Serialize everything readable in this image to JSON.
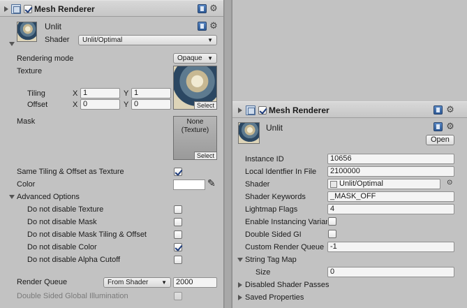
{
  "left": {
    "component": {
      "title": "Mesh Renderer",
      "enabled": true
    },
    "material": {
      "name": "Unlit",
      "shader_label": "Shader",
      "shader_value": "Unlit/Optimal"
    },
    "rendering_mode": {
      "label": "Rendering mode",
      "value": "Opaque"
    },
    "texture": {
      "label": "Texture",
      "select_label": "Select",
      "tiling_label": "Tiling",
      "offset_label": "Offset",
      "x_label": "X",
      "y_label": "Y",
      "tiling_x": "1",
      "tiling_y": "1",
      "offset_x": "0",
      "offset_y": "0"
    },
    "mask": {
      "label": "Mask",
      "none_text": "None\n(Texture)",
      "select_label": "Select"
    },
    "same_tiling": {
      "label": "Same Tiling & Offset as Texture",
      "checked": true
    },
    "color": {
      "label": "Color",
      "value": "#ffffff"
    },
    "advanced": {
      "label": "Advanced Options",
      "options": [
        {
          "label": "Do not disable Texture",
          "checked": false
        },
        {
          "label": "Do not disable Mask",
          "checked": false
        },
        {
          "label": "Do not disable Mask Tiling & Offset",
          "checked": false
        },
        {
          "label": "Do not disable Color",
          "checked": true
        },
        {
          "label": "Do not disable Alpha Cutoff",
          "checked": false
        }
      ]
    },
    "render_queue": {
      "label": "Render Queue",
      "mode": "From Shader",
      "value": "2000"
    },
    "double_sided_gi": {
      "label": "Double Sided Global Illumination",
      "checked": false
    }
  },
  "right": {
    "component": {
      "title": "Mesh Renderer",
      "enabled": true
    },
    "material": {
      "name": "Unlit",
      "open_label": "Open"
    },
    "properties": [
      {
        "label": "Instance ID",
        "value": "10656"
      },
      {
        "label": "Local Identfier In File",
        "value": "2100000"
      },
      {
        "label": "Shader",
        "value": "Unlit/Optimal"
      },
      {
        "label": "Shader Keywords",
        "value": "_MASK_OFF"
      },
      {
        "label": "Lightmap Flags",
        "value": "4"
      },
      {
        "label": "Enable Instancing Variants",
        "checked": false
      },
      {
        "label": "Double Sided GI",
        "checked": false
      },
      {
        "label": "Custom Render Queue",
        "value": "-1"
      }
    ],
    "string_tag_map": {
      "label": "String Tag Map",
      "size_label": "Size",
      "size_value": "0"
    },
    "disabled_passes": {
      "label": "Disabled Shader Passes"
    },
    "saved_properties": {
      "label": "Saved Properties"
    }
  }
}
